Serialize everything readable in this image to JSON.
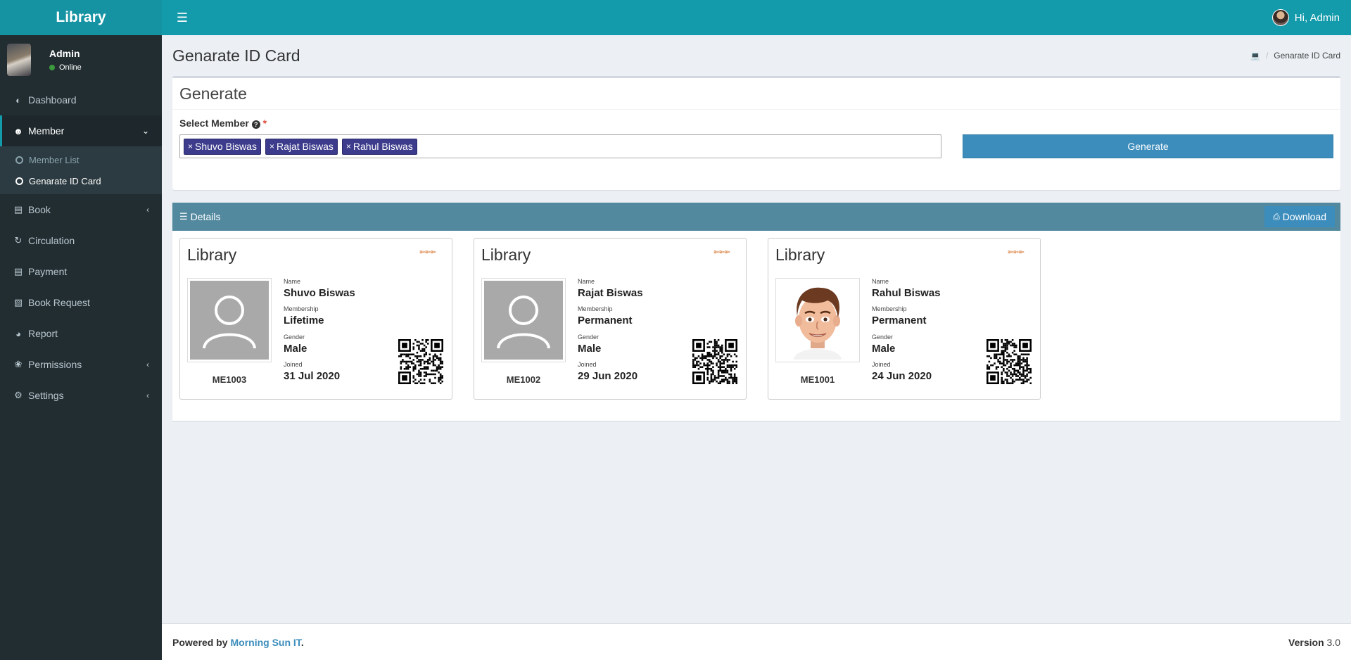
{
  "app": {
    "title": "Library"
  },
  "header": {
    "greeting": "Hi, Admin"
  },
  "user": {
    "name": "Admin",
    "status": "Online"
  },
  "sidebar": {
    "items": [
      {
        "label": "Dashboard"
      },
      {
        "label": "Member"
      },
      {
        "label": "Book"
      },
      {
        "label": "Circulation"
      },
      {
        "label": "Payment"
      },
      {
        "label": "Book Request"
      },
      {
        "label": "Report"
      },
      {
        "label": "Permissions"
      },
      {
        "label": "Settings"
      }
    ],
    "member_sub": [
      {
        "label": "Member List"
      },
      {
        "label": "Genarate ID Card"
      }
    ]
  },
  "page": {
    "title": "Genarate ID Card",
    "breadcrumb": "Genarate ID Card"
  },
  "generate": {
    "header": "Generate",
    "select_label": "Select Member",
    "required_mark": "*",
    "selected": [
      "Shuvo Biswas",
      "Rajat Biswas",
      "Rahul Biswas"
    ],
    "button": "Generate"
  },
  "details": {
    "title": "Details",
    "download": "Download"
  },
  "cards": [
    {
      "org": "Library",
      "id": "ME1003",
      "name_label": "Name",
      "name": "Shuvo Biswas",
      "membership_label": "Membership",
      "membership": "Lifetime",
      "gender_label": "Gender",
      "gender": "Male",
      "joined_label": "Joined",
      "joined": "31 Jul 2020"
    },
    {
      "org": "Library",
      "id": "ME1002",
      "name_label": "Name",
      "name": "Rajat Biswas",
      "membership_label": "Membership",
      "membership": "Permanent",
      "gender_label": "Gender",
      "gender": "Male",
      "joined_label": "Joined",
      "joined": "29 Jun 2020"
    },
    {
      "org": "Library",
      "id": "ME1001",
      "name_label": "Name",
      "name": "Rahul Biswas",
      "membership_label": "Membership",
      "membership": "Permanent",
      "gender_label": "Gender",
      "gender": "Male",
      "joined_label": "Joined",
      "joined": "24 Jun 2020"
    }
  ],
  "footer": {
    "powered": "Powered by",
    "company": "Morning Sun IT",
    "version_label": "Version",
    "version": "3.0"
  },
  "colors": {
    "header": "#139aab",
    "sidebar": "#222d32",
    "accent": "#3c8dbc",
    "tag": "#3c3b8c",
    "details_bar": "#52899f"
  }
}
